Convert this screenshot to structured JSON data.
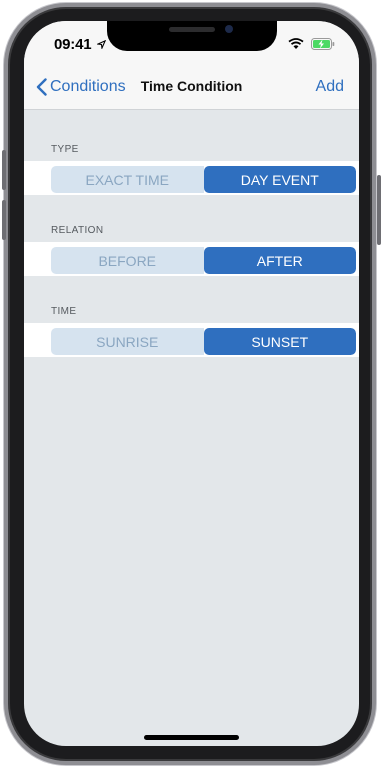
{
  "status_bar": {
    "time": "09:41",
    "icons": [
      "location-arrow-icon",
      "wifi-icon",
      "battery-charging-icon"
    ]
  },
  "nav": {
    "back_label": "Conditions",
    "title": "Time Condition",
    "action_label": "Add"
  },
  "sections": [
    {
      "header": "TYPE",
      "options": [
        "EXACT TIME",
        "DAY EVENT"
      ],
      "selected": 1
    },
    {
      "header": "RELATION",
      "options": [
        "BEFORE",
        "AFTER"
      ],
      "selected": 1
    },
    {
      "header": "TIME",
      "options": [
        "SUNRISE",
        "SUNSET"
      ],
      "selected": 1
    }
  ],
  "colors": {
    "accent": "#2f6fbf",
    "segment_unselected_bg": "#d6e3ef",
    "segment_unselected_text": "#8aa6c1",
    "background": "#e3e7ea"
  }
}
